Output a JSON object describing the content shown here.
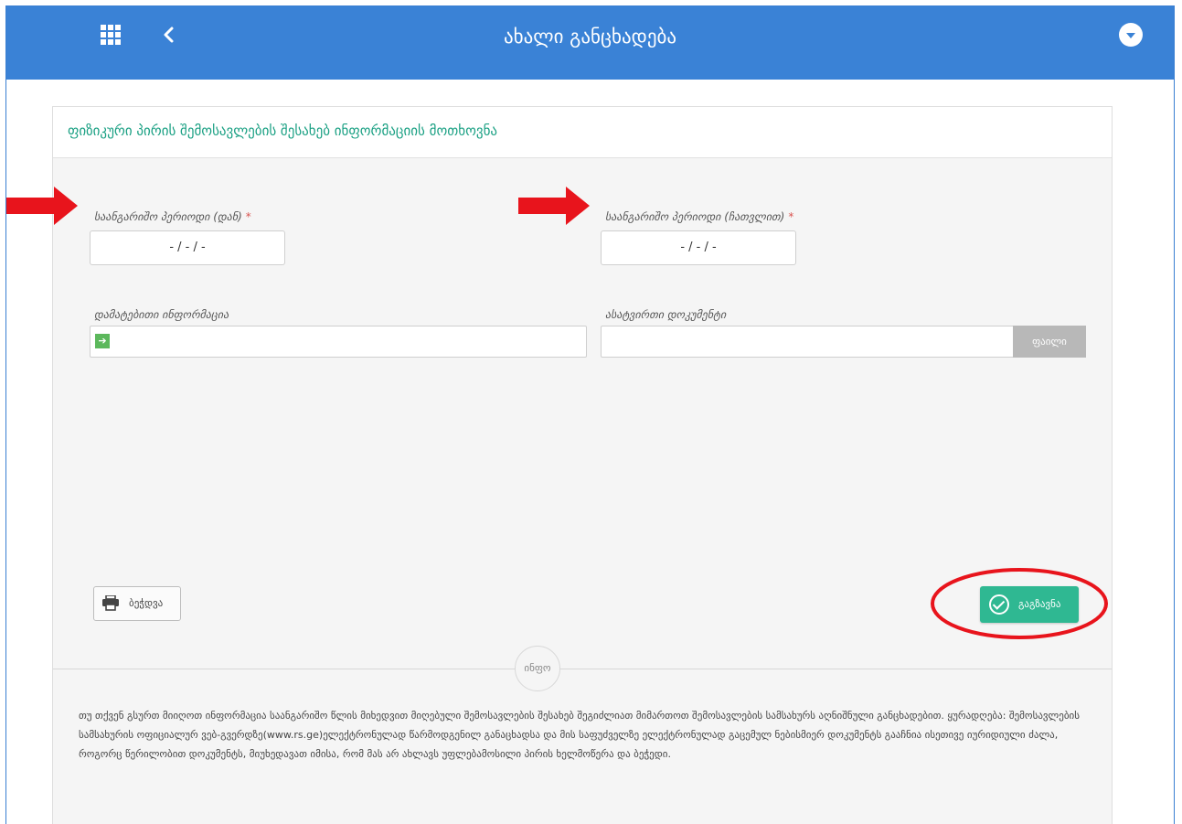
{
  "header": {
    "title": "ახალი განცხადება"
  },
  "panel": {
    "title": "ფიზიკური პირის შემოსავლების შესახებ ინფორმაციის მოთხოვნა"
  },
  "form": {
    "period_from_label": "საანგარიშო პერიოდი (დან)",
    "period_to_label": "საანგარიშო პერიოდი (ჩათვლით)",
    "required_mark": "*",
    "period_from_value": "- / - / -",
    "period_to_value": "- / - / -",
    "additional_info_label": "დამატებითი ინფორმაცია",
    "additional_info_value": "",
    "attachment_label": "ასატვირთი დოკუმენტი",
    "attachment_value": "",
    "file_button": "ფაილი"
  },
  "actions": {
    "print_label": "ბეჭდვა",
    "save_label": "გაგზავნა"
  },
  "info": {
    "circle_label": "ინფო",
    "text": "თუ თქვენ გსურთ მიიღოთ ინფორმაცია საანგარიშო წლის მიხედვით მიღებული შემოსავლების შესახებ შეგიძლიათ მიმართოთ შემოსავლების სამსახურს აღნიშნული განცხადებით. ყურადღება: შემოსავლების სამსახურის ოფიციალურ ვებ-გვერდზე(www.rs.ge)ელექტრონულად წარმოდგენილ განაცხადსა და მის საფუძველზე ელექტრონულად გაცემულ ნებისმიერ დოკუმენტს გააჩნია ისეთივე იურიდიული ძალა, როგორც წერილობით დოკუმენტს, მიუხედავათ იმისა, რომ მას არ ახლავს უფლებამოსილი პირის ხელმოწერა და ბეჭედი."
  },
  "colors": {
    "header_blue": "#3a82d6",
    "accent_green": "#1aa083",
    "save_green": "#2fb892",
    "annotation_red": "#e8141c"
  }
}
